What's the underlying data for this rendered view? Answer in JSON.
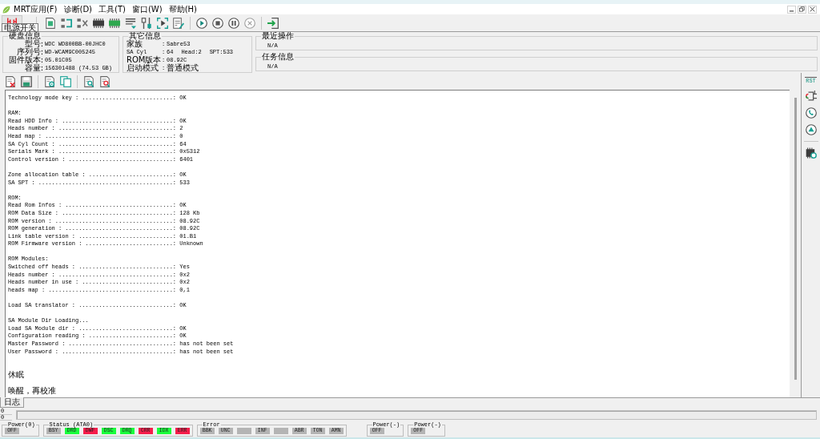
{
  "menu_bar": {
    "items": [
      "MRT应用(F)",
      "诊断(D)",
      "工具(T)",
      "窗口(W)",
      "帮助(H)"
    ]
  },
  "toolbar": {
    "tooltip": "电源开关"
  },
  "disk_info": {
    "title": "硬盘信息",
    "rows": [
      {
        "label": "型号:",
        "value": "WDC WD800BB-00JHC0"
      },
      {
        "label": "序列号:",
        "value": "WD-WCAM9C005245"
      },
      {
        "label": "固件版本:",
        "value": "05.01C05"
      },
      {
        "label": "容量:",
        "value": "156301488 (74.53 GB)"
      }
    ]
  },
  "other_info": {
    "title": "其它信息",
    "rows": [
      {
        "label": "家族",
        "sep": ":",
        "values": [
          "Sabre53"
        ]
      },
      {
        "label": "SA Cyl",
        "sep": ":",
        "values": [
          "64",
          "Head:2",
          "SPT:533"
        ]
      },
      {
        "label": "ROM版本",
        "sep": ":",
        "values": [
          "08.92C"
        ]
      },
      {
        "label": "启动模式",
        "sep": ":",
        "values": [
          "普通模式"
        ]
      }
    ]
  },
  "recent_operation": {
    "title": "最近操作",
    "value": "N/A"
  },
  "task_info": {
    "title": "任务信息",
    "value": "N/A"
  },
  "side_toolbar": {
    "reset_label": "RST"
  },
  "log": {
    "blocks": [
      {
        "kind": "report",
        "lines": [
          "Technology mode key : ...........................: OK"
        ]
      },
      {
        "kind": "report",
        "lines": [
          "RAM:",
          "Read HDD Info : .................................: OK",
          "Heads number : ..................................: 2",
          "Head map : ......................................: 0",
          "SA Cyl Count : ..................................: 64",
          "Serials Mark : ..................................: 0x5312",
          "Control version : ...............................: 6401"
        ]
      },
      {
        "kind": "report",
        "lines": [
          "Zone allocation table : .........................: OK",
          "SA SPT : ........................................: 533"
        ]
      },
      {
        "kind": "report",
        "lines": [
          "ROM:",
          "Read Rom Infos : ................................: OK",
          "ROM Data Size : .................................: 128 Kb",
          "ROM version : ...................................: 08.92C",
          "ROM generation : ................................: 08.92C",
          "Link table version : ............................: 01.B1",
          "ROM Firmware version : ..........................: Unknown"
        ]
      },
      {
        "kind": "report",
        "lines": [
          "ROM Modules:",
          "Switched off heads : ............................: Yes",
          "Heads number : ..................................: 0x2",
          "Heads number in use : ...........................: 0x2",
          "heads map : .....................................: 0,1"
        ]
      },
      {
        "kind": "report",
        "lines": [
          "Load SA translator : ............................: OK"
        ]
      },
      {
        "kind": "report",
        "lines": [
          "SA Module Dir Loading...",
          "Load SA Module dir : ............................: OK",
          "Configuration reading : .........................: OK",
          "Master Password : ...............................: has not been set",
          "User Password : .................................: has not been set"
        ]
      },
      {
        "kind": "message",
        "lines": [
          "休眠"
        ]
      },
      {
        "kind": "message",
        "lines": [
          "唤醒，再校准"
        ]
      }
    ]
  },
  "tabs": [
    {
      "label": "日志",
      "selected": true
    }
  ],
  "progress": {
    "counters": [
      "0",
      "0"
    ]
  },
  "status_bar": {
    "groups": [
      {
        "title": "Power(0)",
        "indicators": [
          {
            "label": "OFF",
            "color": "#b4b4b4"
          }
        ]
      },
      {
        "title": "Status (ATA0)",
        "indicators": [
          {
            "label": "BSY",
            "color": "#b4b4b4"
          },
          {
            "label": "DRD",
            "color": "#19ff3c"
          },
          {
            "label": "DWF",
            "color": "#f51e4b"
          },
          {
            "label": "DSC",
            "color": "#19ff3c"
          },
          {
            "label": "DRQ",
            "color": "#19ff3c"
          },
          {
            "label": "CRR",
            "color": "#f51e4b"
          },
          {
            "label": "IDX",
            "color": "#19ff3c"
          },
          {
            "label": "ERR",
            "color": "#f51e4b"
          }
        ]
      },
      {
        "title": "Error",
        "indicators": [
          {
            "label": "BBK",
            "color": "#b4b4b4"
          },
          {
            "label": "UNC",
            "color": "#b4b4b4"
          },
          {
            "color": "#b4b4b4"
          },
          {
            "label": "INF",
            "color": "#b4b4b4"
          },
          {
            "color": "#b4b4b4"
          },
          {
            "label": "ABR",
            "color": "#b4b4b4"
          },
          {
            "label": "TON",
            "color": "#b4b4b4"
          },
          {
            "label": "AMN",
            "color": "#b4b4b4"
          }
        ]
      },
      {
        "title": "Power(-)",
        "indicators": [
          {
            "label": "OFF",
            "color": "#b4b4b4"
          }
        ]
      },
      {
        "title": "Power(-)",
        "indicators": [
          {
            "label": "OFF",
            "color": "#b4b4b4"
          }
        ]
      }
    ]
  }
}
